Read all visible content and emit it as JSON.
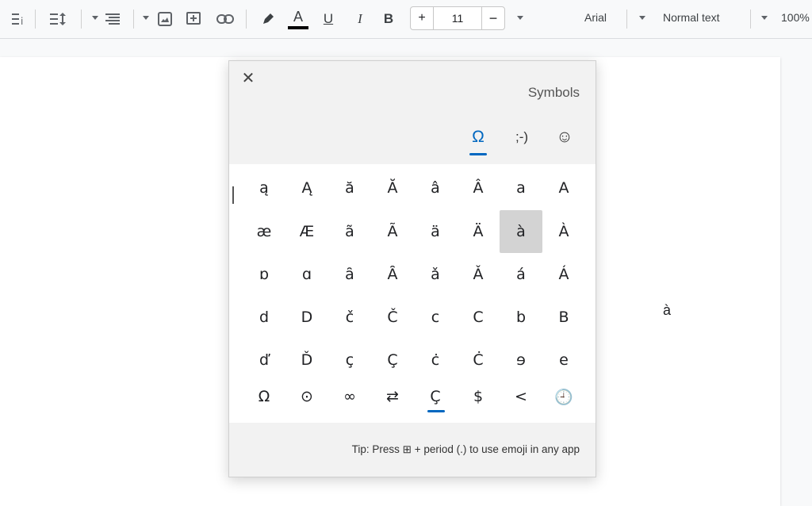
{
  "toolbar": {
    "zoom": "100%",
    "style": "Normal text",
    "font": "Arial",
    "font_size": "11",
    "minus": "−",
    "plus": "+",
    "bold": "B",
    "italic": "I",
    "underline": "U",
    "text_color": "A",
    "text_color_value": "#000000",
    "highlight_icon": "pencil-icon",
    "link_icon": "link-icon",
    "comment_icon": "add-comment-icon",
    "image_icon": "image-icon",
    "align_icon": "align-icon",
    "line_spacing_icon": "line-spacing-icon",
    "checklist_icon": "checklist-icon",
    "list_icon": "bullet-list-icon"
  },
  "document": {
    "inserted_char": "à"
  },
  "symbols_panel": {
    "title": "Symbols",
    "close_icon": "close-icon",
    "tabs": [
      {
        "label": "☺",
        "icon": "emoji-icon",
        "active": false
      },
      {
        "label": ";-)",
        "icon": "kaomoji-icon",
        "active": false
      },
      {
        "label": "Ω",
        "icon": "symbols-icon",
        "active": true
      }
    ],
    "grid": [
      [
        "A",
        "a",
        "Â",
        "â",
        "Ă",
        "ă",
        "Ą",
        "ą"
      ],
      [
        "À",
        "à",
        "Ä",
        "ä",
        "Ã",
        "ã",
        "Æ",
        "æ"
      ],
      [
        "Á",
        "á",
        "Ǎ",
        "ǎ",
        "Ȃ",
        "ȃ",
        "ɑ",
        "ɒ"
      ],
      [
        "B",
        "b",
        "C",
        "c",
        "Č",
        "č",
        "D",
        "d"
      ],
      [
        "e",
        "ɘ",
        "Ċ",
        "ċ",
        "Ç",
        "ç",
        "Ď",
        "ď"
      ],
      [
        "🕘",
        "<",
        "$",
        "Ç",
        "⇄",
        "∞",
        "⊙",
        "Ω"
      ]
    ],
    "selected": "à",
    "tip": "Tip: Press ⊞ + period (.) to use emoji in any app",
    "accent_color": "#0067c0"
  }
}
